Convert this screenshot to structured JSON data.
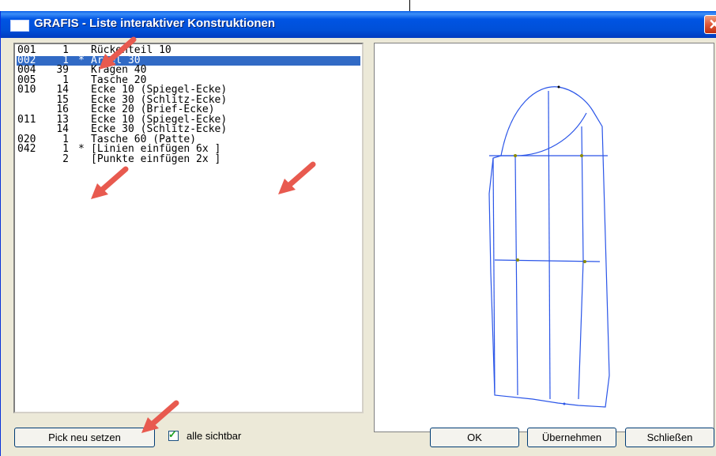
{
  "window": {
    "title": "GRAFIS - Liste interaktiver Konstruktionen",
    "close_glyph": "✕"
  },
  "list": {
    "rows": [
      {
        "code": "001",
        "num": "1",
        "mark": "",
        "name": "Rückenteil 10"
      },
      {
        "code": "002",
        "num": "1",
        "mark": "*",
        "name": "Ärmel 30"
      },
      {
        "code": "004",
        "num": "39",
        "mark": "",
        "name": "Kragen 40"
      },
      {
        "code": "005",
        "num": "1",
        "mark": "",
        "name": "Tasche 20"
      },
      {
        "code": "010",
        "num": "14",
        "mark": "",
        "name": "Ecke 10 (Spiegel-Ecke)"
      },
      {
        "code": "",
        "num": "15",
        "mark": "",
        "name": "Ecke 30 (Schlitz-Ecke)"
      },
      {
        "code": "",
        "num": "16",
        "mark": "",
        "name": "Ecke 20 (Brief-Ecke)"
      },
      {
        "code": "011",
        "num": "13",
        "mark": "",
        "name": "Ecke 10 (Spiegel-Ecke)"
      },
      {
        "code": "",
        "num": "14",
        "mark": "",
        "name": "Ecke 30 (Schlitz-Ecke)"
      },
      {
        "code": "020",
        "num": "1",
        "mark": "",
        "name": "Tasche 60 (Patte)"
      },
      {
        "code": "042",
        "num": "1",
        "mark": "*",
        "name": "[Linien einfügen 6x ]"
      },
      {
        "code": "",
        "num": "2",
        "mark": "",
        "name": "[Punkte einfügen 2x ]"
      }
    ]
  },
  "bottom": {
    "pick_label": "Pick neu setzen",
    "checkbox_label": "alle sichtbar",
    "checkbox_checked": true,
    "ok_label": "OK",
    "apply_label": "Übernehmen",
    "close_label": "Schließen"
  },
  "colors": {
    "selection": "#316ac5",
    "title_bar": "#0054e3",
    "pattern_line": "#2a55e8",
    "arrow": "#e85a4f"
  }
}
